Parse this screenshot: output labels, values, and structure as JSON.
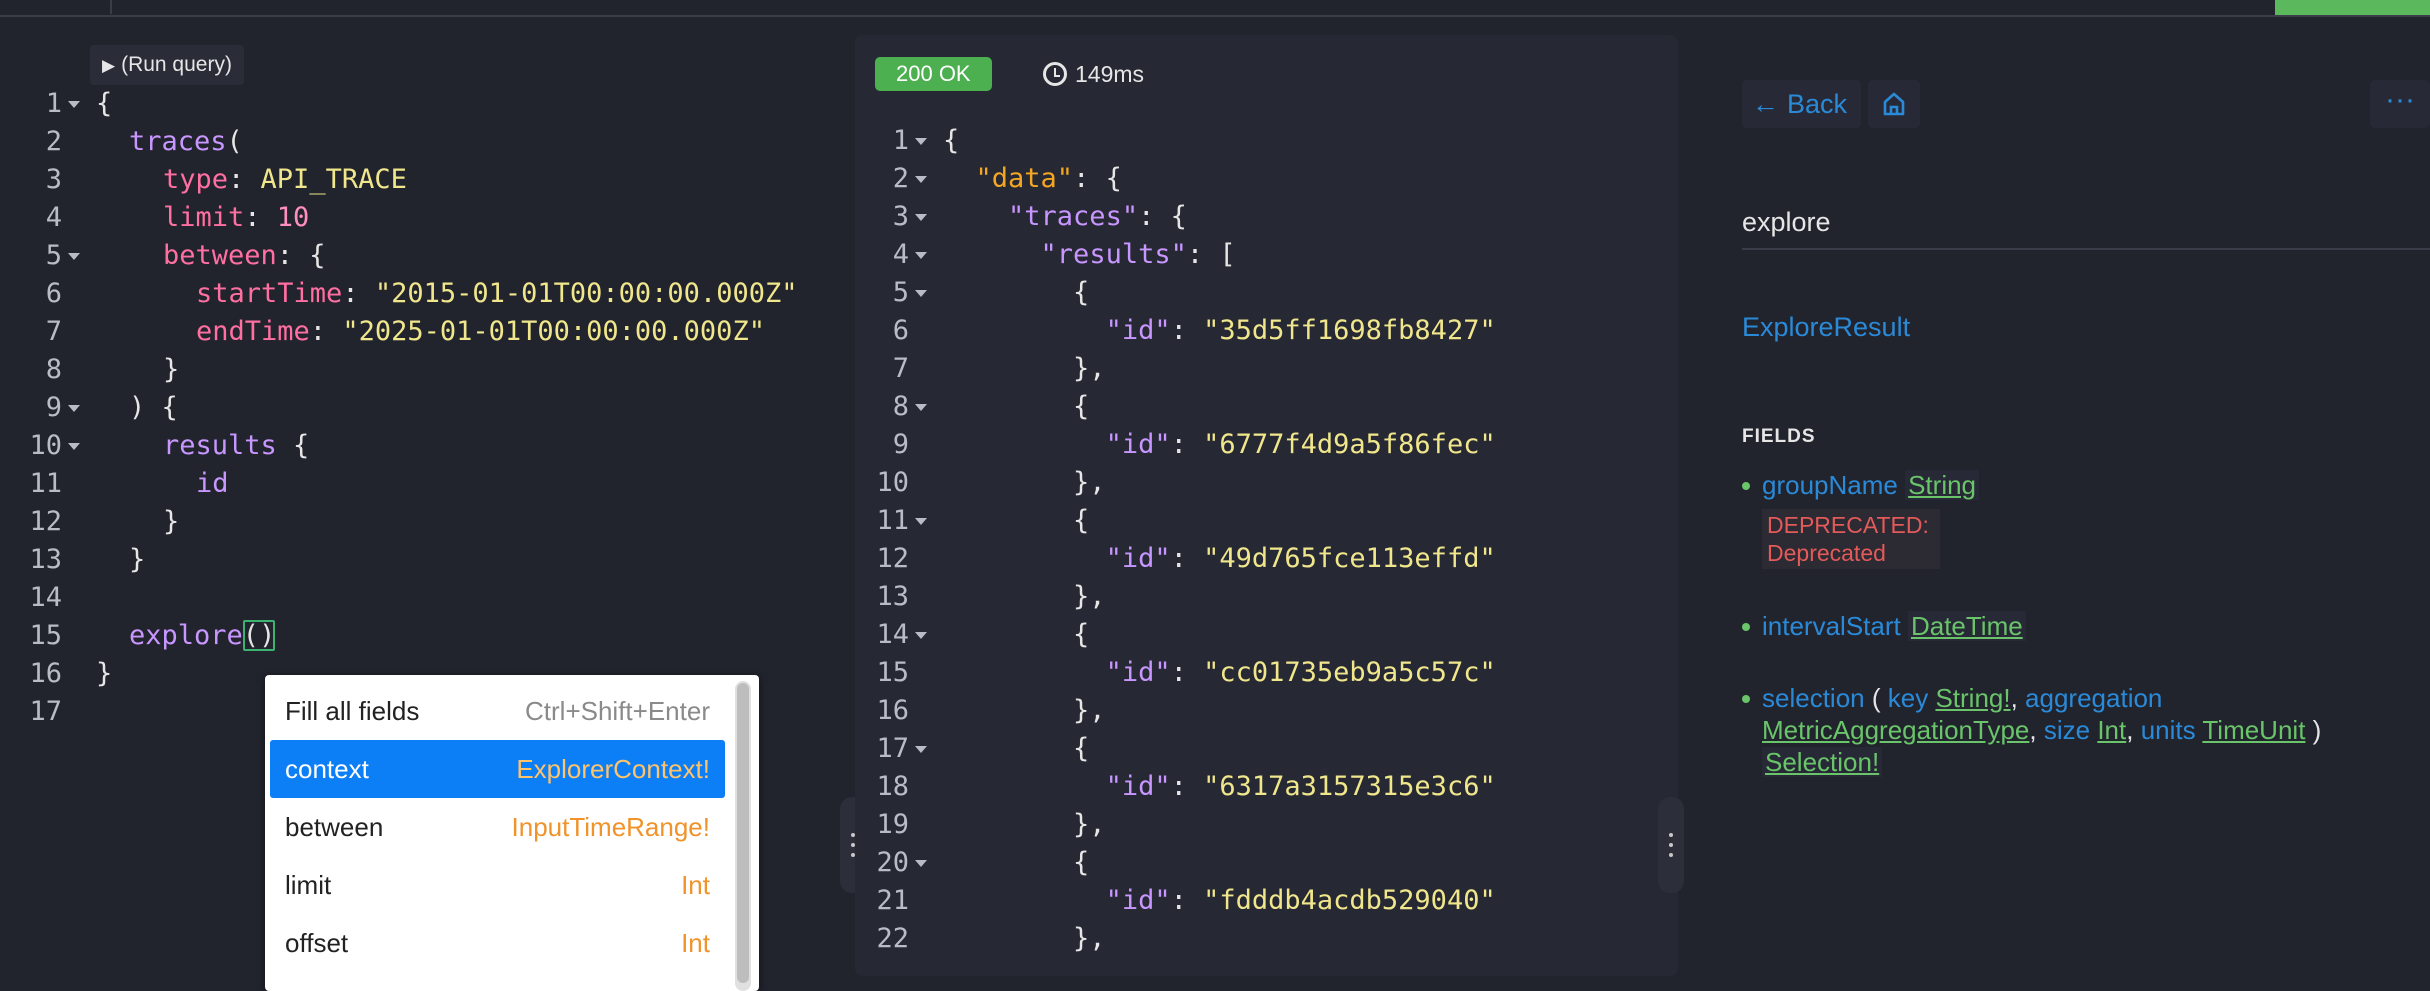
{
  "editor": {
    "run_label": "(Run query)",
    "lines": [
      {
        "n": "1",
        "fold": true
      },
      {
        "n": "2",
        "fold": false
      },
      {
        "n": "3",
        "fold": false
      },
      {
        "n": "4",
        "fold": false
      },
      {
        "n": "5",
        "fold": true
      },
      {
        "n": "6",
        "fold": false
      },
      {
        "n": "7",
        "fold": false
      },
      {
        "n": "8",
        "fold": false
      },
      {
        "n": "9",
        "fold": true
      },
      {
        "n": "10",
        "fold": true
      },
      {
        "n": "11",
        "fold": false
      },
      {
        "n": "12",
        "fold": false
      },
      {
        "n": "13",
        "fold": false
      },
      {
        "n": "14",
        "fold": false
      },
      {
        "n": "15",
        "fold": false
      },
      {
        "n": "16",
        "fold": false
      },
      {
        "n": "17",
        "fold": false
      }
    ],
    "code": {
      "l1": "{",
      "l2_field": "traces",
      "l2_rest": "(",
      "l3_arg": "type",
      "l3_colon": ": ",
      "l3_val": "API_TRACE",
      "l4_arg": "limit",
      "l4_colon": ": ",
      "l4_val": "10",
      "l5_arg": "between",
      "l5_rest": ": {",
      "l6_arg": "startTime",
      "l6_colon": ": ",
      "l6_val": "\"2015-01-01T00:00:00.000Z\"",
      "l7_arg": "endTime",
      "l7_colon": ": ",
      "l7_val": "\"2025-01-01T00:00:00.000Z\"",
      "l8": "}",
      "l9": ") {",
      "l10_field": "results",
      "l10_rest": " {",
      "l11_field": "id",
      "l12": "}",
      "l13": "}",
      "l15_field": "explore",
      "l15_open": "(",
      "l15_close": ")",
      "l16": "}"
    }
  },
  "autocomplete": {
    "header_name": "Fill all fields",
    "header_shortcut": "Ctrl+Shift+Enter",
    "items": [
      {
        "name": "context",
        "type": "ExplorerContext!"
      },
      {
        "name": "between",
        "type": "InputTimeRange!"
      },
      {
        "name": "limit",
        "type": "Int"
      },
      {
        "name": "offset",
        "type": "Int"
      }
    ]
  },
  "result": {
    "status": "200 OK",
    "timing": "149ms",
    "lines": [
      {
        "n": "1",
        "fold": true,
        "indent": "",
        "t": "{"
      },
      {
        "n": "2",
        "fold": true,
        "indent": "  ",
        "k": "\"data\"",
        "dk": true,
        "t": ": {"
      },
      {
        "n": "3",
        "fold": true,
        "indent": "    ",
        "k": "\"traces\"",
        "t": ": {"
      },
      {
        "n": "4",
        "fold": true,
        "indent": "      ",
        "k": "\"results\"",
        "t": ": ["
      },
      {
        "n": "5",
        "fold": true,
        "indent": "        ",
        "t": "{"
      },
      {
        "n": "6",
        "fold": false,
        "indent": "          ",
        "k": "\"id\"",
        "t": ": ",
        "v": "\"35d5ff1698fb8427\""
      },
      {
        "n": "7",
        "fold": false,
        "indent": "        ",
        "t": "},"
      },
      {
        "n": "8",
        "fold": true,
        "indent": "        ",
        "t": "{"
      },
      {
        "n": "9",
        "fold": false,
        "indent": "          ",
        "k": "\"id\"",
        "t": ": ",
        "v": "\"6777f4d9a5f86fec\""
      },
      {
        "n": "10",
        "fold": false,
        "indent": "        ",
        "t": "},"
      },
      {
        "n": "11",
        "fold": true,
        "indent": "        ",
        "t": "{"
      },
      {
        "n": "12",
        "fold": false,
        "indent": "          ",
        "k": "\"id\"",
        "t": ": ",
        "v": "\"49d765fce113effd\""
      },
      {
        "n": "13",
        "fold": false,
        "indent": "        ",
        "t": "},"
      },
      {
        "n": "14",
        "fold": true,
        "indent": "        ",
        "t": "{"
      },
      {
        "n": "15",
        "fold": false,
        "indent": "          ",
        "k": "\"id\"",
        "t": ": ",
        "v": "\"cc01735eb9a5c57c\""
      },
      {
        "n": "16",
        "fold": false,
        "indent": "        ",
        "t": "},"
      },
      {
        "n": "17",
        "fold": true,
        "indent": "        ",
        "t": "{"
      },
      {
        "n": "18",
        "fold": false,
        "indent": "          ",
        "k": "\"id\"",
        "t": ": ",
        "v": "\"6317a3157315e3c6\""
      },
      {
        "n": "19",
        "fold": false,
        "indent": "        ",
        "t": "},"
      },
      {
        "n": "20",
        "fold": true,
        "indent": "        ",
        "t": "{"
      },
      {
        "n": "21",
        "fold": false,
        "indent": "          ",
        "k": "\"id\"",
        "t": ": ",
        "v": "\"fdddb4acdb529040\""
      },
      {
        "n": "22",
        "fold": false,
        "indent": "        ",
        "t": "},"
      }
    ]
  },
  "docs": {
    "back_label": "Back",
    "home_icon": "home-icon",
    "more_label": "···",
    "title": "explore",
    "type": "ExploreResult",
    "fields_heading": "FIELDS",
    "fields": {
      "f1_name": "groupName",
      "f1_type": "String",
      "f1_dep": "DEPRECATED: Deprecated",
      "f2_name": "intervalStart",
      "f2_type": "DateTime",
      "f3_name": "selection",
      "f3_open": " ( ",
      "f3_arg1": "key",
      "f3_arg1_type": "String!",
      "f3_comma1": ", ",
      "f3_arg2": "aggregation",
      "f3_arg2_type": "MetricAggregationType",
      "f3_comma2": ", ",
      "f3_arg3": "size",
      "f3_arg3_type": "Int",
      "f3_comma3": ", ",
      "f3_arg4": "units",
      "f3_arg4_type": "TimeUnit",
      "f3_close": " )",
      "f3_type": "Selection!"
    }
  }
}
